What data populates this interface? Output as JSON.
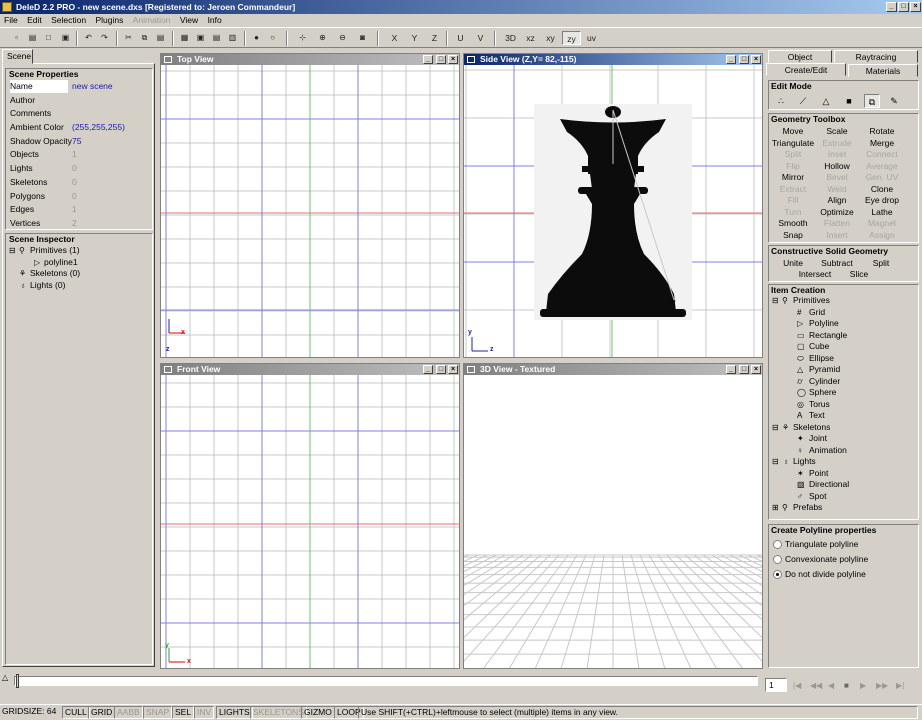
{
  "window": {
    "title": "DeleD 2.2 PRO - new scene.dxs  [Registered to: Jeroen Commandeur]"
  },
  "menu": [
    "File",
    "Edit",
    "Selection",
    "Plugins",
    "Animation",
    "View",
    "Info"
  ],
  "menu_disabled": [
    "Animation"
  ],
  "toolbar": {
    "axis_buttons": [
      "X",
      "Y",
      "Z"
    ],
    "uv_buttons": [
      "U",
      "V"
    ],
    "view_buttons": [
      "3D",
      "xz",
      "xy",
      "zy",
      "uv"
    ],
    "active_view_button": "zy"
  },
  "left_panel": {
    "tab": "Scene",
    "scene_properties": {
      "title": "Scene Properties",
      "rows": [
        {
          "key": "Name",
          "value": "new scene",
          "active": true
        },
        {
          "key": "Author",
          "value": ""
        },
        {
          "key": "Comments",
          "value": ""
        },
        {
          "key": "Ambient Color",
          "value": "(255,255,255)"
        },
        {
          "key": "Shadow Opacity",
          "value": "75"
        },
        {
          "key": "Objects",
          "value": "1",
          "gray": true
        },
        {
          "key": "Lights",
          "value": "0",
          "gray": true
        },
        {
          "key": "Skeletons",
          "value": "0",
          "gray": true
        },
        {
          "key": "Polygons",
          "value": "0",
          "gray": true
        },
        {
          "key": "Edges",
          "value": "1",
          "gray": true
        },
        {
          "key": "Vertices",
          "value": "2",
          "gray": true
        }
      ]
    },
    "scene_inspector": {
      "title": "Scene Inspector",
      "items": [
        "Primitives (1)",
        "polyline1",
        "Skeletons (0)",
        "Lights (0)"
      ]
    }
  },
  "viewports": {
    "top": {
      "title": "Top View",
      "axes": [
        "x",
        "z"
      ]
    },
    "side": {
      "title": "Side View (Z,Y= 82,-115)",
      "axes": [
        "y",
        "z"
      ]
    },
    "front": {
      "title": "Front View",
      "axes": [
        "y",
        "x"
      ]
    },
    "perspective": {
      "title": "3D View - Textured"
    }
  },
  "right_panel": {
    "tabs_row1": [
      "Object",
      "Raytracing"
    ],
    "tabs_row2": [
      "Create/Edit",
      "Materials"
    ],
    "active_tab": "Create/Edit",
    "edit_mode": {
      "title": "Edit Mode",
      "icons": [
        "vertex-mode-icon",
        "edge-mode-icon",
        "polygon-mode-icon",
        "object-mode-icon",
        "group-mode-icon",
        "pencil-mode-icon"
      ]
    },
    "geometry_toolbox": {
      "title": "Geometry Toolbox",
      "rows": [
        [
          {
            "l": "Move",
            "s": "bold"
          },
          {
            "l": "Scale"
          },
          {
            "l": "Rotate"
          }
        ],
        [
          {
            "l": "Triangulate"
          },
          {
            "l": "Extrude",
            "s": "dis"
          },
          {
            "l": "Merge"
          }
        ],
        [
          {
            "l": "Split",
            "s": "dis"
          },
          {
            "l": "Inset",
            "s": "dis"
          },
          {
            "l": "Connect",
            "s": "dis"
          }
        ],
        [
          {
            "l": "Flip",
            "s": "dis"
          },
          {
            "l": "Hollow"
          },
          {
            "l": "Average",
            "s": "dis"
          }
        ],
        [
          {
            "l": "Mirror"
          },
          {
            "l": "Bevel",
            "s": "dis"
          },
          {
            "l": "Gen. UV",
            "s": "dis"
          }
        ],
        [
          {
            "l": "Extract",
            "s": "dis"
          },
          {
            "l": "Weld",
            "s": "dis"
          },
          {
            "l": "Clone"
          }
        ],
        [
          {
            "l": "Fill",
            "s": "dis"
          },
          {
            "l": "Align"
          },
          {
            "l": "Eye drop"
          }
        ],
        [
          {
            "l": "Turn",
            "s": "dis"
          },
          {
            "l": "Optimize"
          },
          {
            "l": "Lathe"
          }
        ],
        [
          {
            "l": "Smooth"
          },
          {
            "l": "Flatten",
            "s": "dis"
          },
          {
            "l": "Magnet",
            "s": "dis"
          }
        ],
        [
          {
            "l": "Snap"
          },
          {
            "l": "Insert",
            "s": "dis"
          },
          {
            "l": "Assign",
            "s": "dis"
          }
        ]
      ]
    },
    "csg": {
      "title": "Constructive Solid Geometry",
      "buttons": [
        "Unite",
        "Subtract",
        "Split",
        "Intersect",
        "Slice"
      ]
    },
    "item_creation": {
      "title": "Item Creation",
      "primitives": "Primitives",
      "primitive_items": [
        "Grid",
        "Polyline",
        "Rectangle",
        "Cube",
        "Ellipse",
        "Pyramid",
        "Cylinder",
        "Sphere",
        "Torus",
        "Text"
      ],
      "skeletons": "Skeletons",
      "skeleton_items": [
        "Joint",
        "Animation"
      ],
      "lights": "Lights",
      "light_items": [
        "Point",
        "Directional",
        "Spot"
      ],
      "prefabs": "Prefabs"
    },
    "polyline_props": {
      "title": "Create Polyline properties",
      "options": [
        "Triangulate polyline",
        "Convexionate polyline",
        "Do not divide polyline"
      ],
      "selected": 2
    }
  },
  "timeline": {
    "frame": "1"
  },
  "statusbar": {
    "gridsize": "GRIDSIZE: 64",
    "toggles": [
      {
        "l": "CULL"
      },
      {
        "l": "GRID"
      },
      {
        "l": "AABB",
        "dis": true
      },
      {
        "l": "SNAP",
        "dis": true
      },
      {
        "l": "SEL"
      },
      {
        "l": "INV",
        "dis": true
      },
      {
        "l": "LIGHTS"
      },
      {
        "l": "SKELETONS",
        "dis": true
      },
      {
        "l": "GIZMO"
      },
      {
        "l": "LOOP"
      }
    ],
    "hint": "Use SHIFT(+CTRL)+leftmouse to select (multiple) items in any view."
  }
}
